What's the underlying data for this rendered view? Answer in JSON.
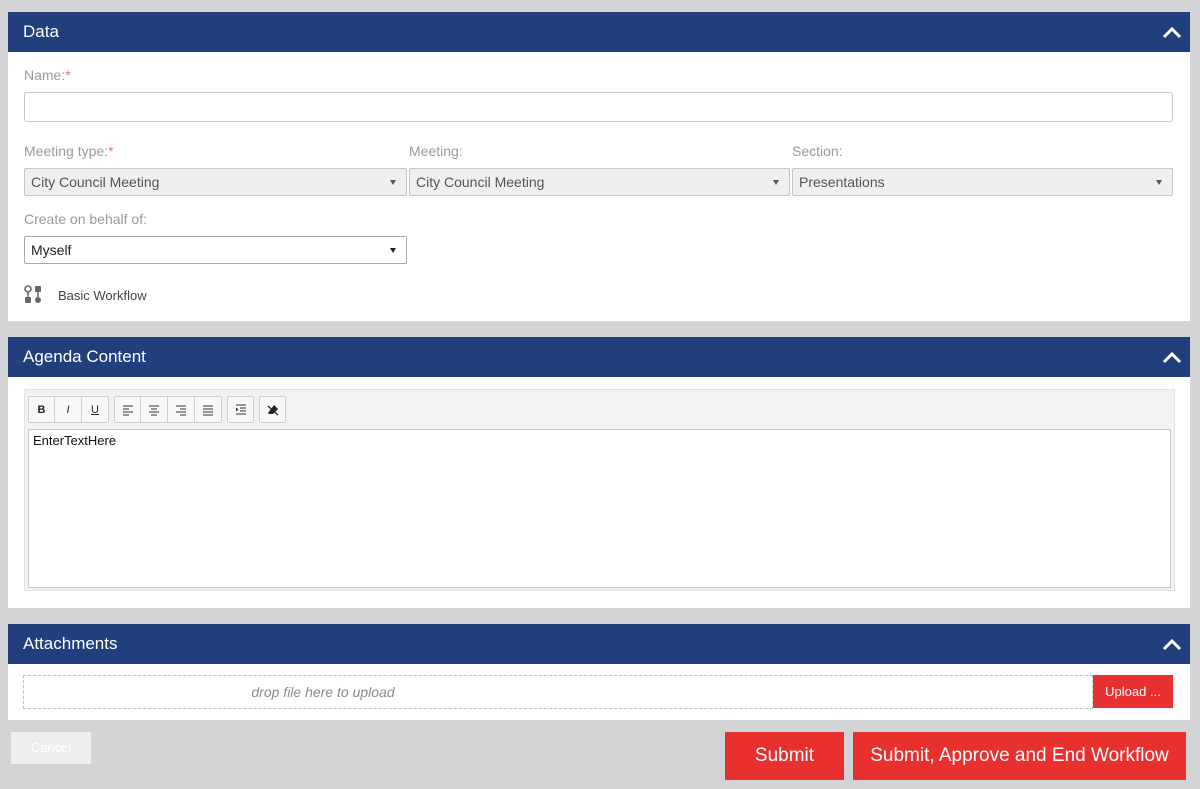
{
  "data_panel": {
    "title": "Data",
    "name_label": "Name:",
    "name_value": "",
    "meeting_type_label": "Meeting type:",
    "meeting_type_value": "City Council Meeting",
    "meeting_label": "Meeting:",
    "meeting_value": "City Council Meeting",
    "section_label": "Section:",
    "section_value": "Presentations",
    "behalf_label": "Create on behalf of:",
    "behalf_value": "Myself",
    "workflow_label": "Basic Workflow",
    "required_mark": "*"
  },
  "agenda_panel": {
    "title": "Agenda Content",
    "toolbar": {
      "bold": "B",
      "italic": "I",
      "underline": "U"
    },
    "editor_text": "EnterTextHere"
  },
  "attachments_panel": {
    "title": "Attachments",
    "dropzone_text": "drop file here to upload",
    "upload_label": "Upload ..."
  },
  "actions": {
    "cancel_label": "Cancel",
    "submit_label": "Submit",
    "submit_end_label": "Submit, Approve and End Workflow"
  },
  "colors": {
    "header": "#223f7d",
    "accent_red": "#e8302f"
  }
}
